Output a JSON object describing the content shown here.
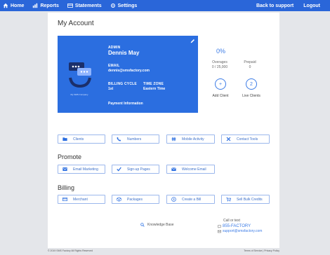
{
  "nav": {
    "home": "Home",
    "reports": "Reports",
    "statements": "Statements",
    "settings": "Settings",
    "back_to_support": "Back to support",
    "logout": "Logout"
  },
  "page": {
    "title": "My Account"
  },
  "account": {
    "role_label": "ADMIN",
    "name": "Dennis May",
    "email_label": "EMAIL",
    "email": "dennis@smsfactory.com",
    "billing_cycle_label": "BILLING CYCLE",
    "billing_cycle": "1st",
    "timezone_label": "TIME ZONE",
    "timezone": "Eastern Time",
    "payment_info": "Payment Information",
    "logo_caption": "My SMS Company"
  },
  "stats": {
    "percent": "0%",
    "overages_label": "Overages",
    "overages_value": "0 / 25,000",
    "prepaid_label": "Prepaid",
    "prepaid_value": "0",
    "add_client_icon": "+",
    "add_client_label": "Add Client",
    "live_clients_count": "2",
    "live_clients_label": "Live Clients"
  },
  "quick_links": {
    "clients": "Clients",
    "numbers": "Numbers",
    "mobile_activity": "Mobile Activity",
    "contact_tools": "Contact Tools"
  },
  "promote": {
    "title": "Promote",
    "email_marketing": "Email Marketing",
    "signup_pages": "Sign-up Pages",
    "welcome_email": "Welcome Email"
  },
  "billing": {
    "title": "Billing",
    "merchant": "Merchant",
    "packages": "Packages",
    "create_bill": "Create a Bill",
    "sell_bulk_credits": "Sell Bulk Credits"
  },
  "help": {
    "knowledge_base": "Knowledge Base",
    "call_or_text": "Call or text",
    "phone": "855-FACTORY",
    "email": "support@smsfactory.com"
  },
  "footer": {
    "copyright": "© 2019 SMS Factory All Rights Reserved",
    "terms": "Terms of Service",
    "separator": " | ",
    "privacy": "Privacy Policy"
  },
  "colors": {
    "brand": "#2a66d9",
    "accent": "#3b7be6",
    "panel": "#2b6ee0"
  },
  "icons": [
    "home-icon",
    "reports-icon",
    "statements-icon",
    "settings-icon",
    "pencil-icon",
    "folder-icon",
    "phone-icon",
    "hash-icon",
    "tools-icon",
    "email-icon",
    "check-icon",
    "envelope-icon",
    "card-icon",
    "box-icon",
    "dollar-icon",
    "cart-icon",
    "search-icon",
    "chat-icon"
  ]
}
